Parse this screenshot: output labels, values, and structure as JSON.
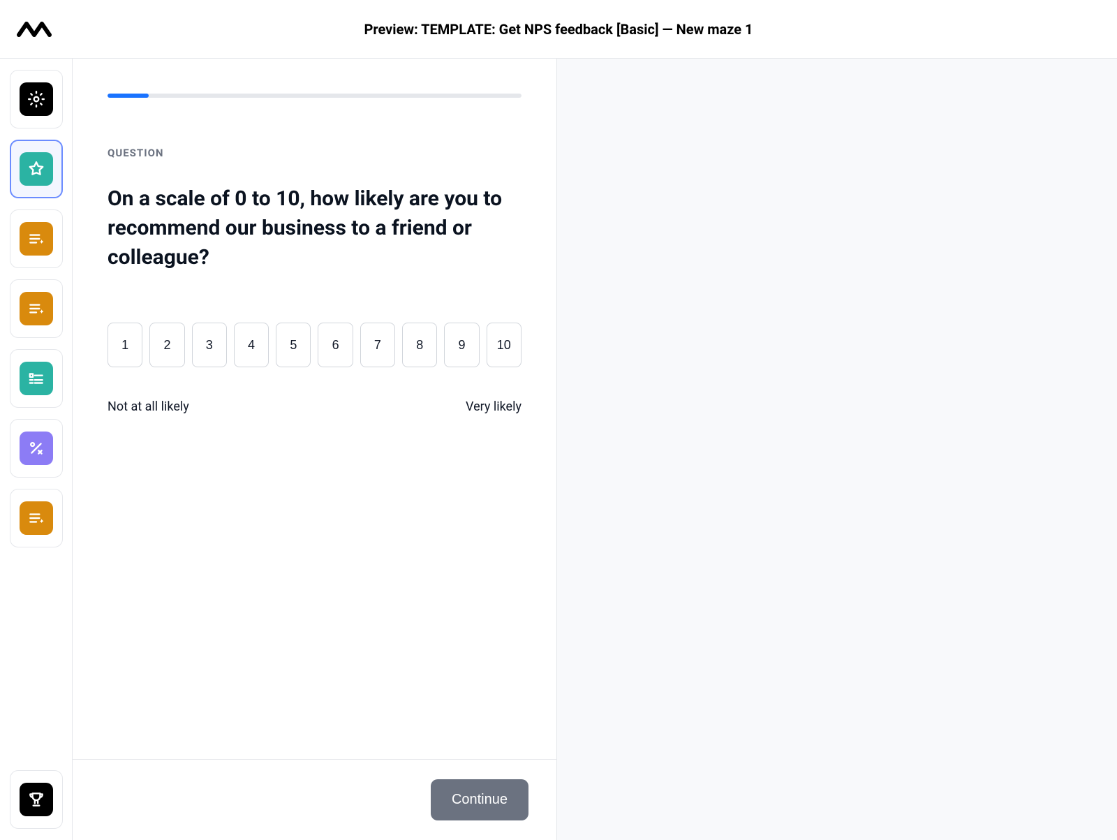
{
  "header": {
    "title": "Preview: TEMPLATE: Get NPS feedback [Basic] — New maze 1"
  },
  "sidebar": {
    "items": [
      {
        "name": "setup",
        "icon": "gear",
        "bg": "bg-black"
      },
      {
        "name": "star-question",
        "icon": "star",
        "bg": "bg-teal",
        "active": true
      },
      {
        "name": "followup-1",
        "icon": "lines-sparkle",
        "bg": "bg-orange"
      },
      {
        "name": "followup-2",
        "icon": "lines-sparkle",
        "bg": "bg-orange"
      },
      {
        "name": "list",
        "icon": "list",
        "bg": "bg-teal"
      },
      {
        "name": "percent",
        "icon": "percent",
        "bg": "bg-purple"
      },
      {
        "name": "followup-3",
        "icon": "lines-sparkle",
        "bg": "bg-orange"
      }
    ],
    "bottom": {
      "name": "trophy",
      "icon": "trophy",
      "bg": "bg-black"
    }
  },
  "progress": {
    "percent": 10
  },
  "question": {
    "label": "QUESTION",
    "text": "On a scale of 0 to 10, how likely are you to recommend our business to a friend or colleague?"
  },
  "scale": {
    "options": [
      "1",
      "2",
      "3",
      "4",
      "5",
      "6",
      "7",
      "8",
      "9",
      "10"
    ],
    "low_label": "Not at all likely",
    "high_label": "Very likely"
  },
  "footer": {
    "continue_label": "Continue"
  }
}
